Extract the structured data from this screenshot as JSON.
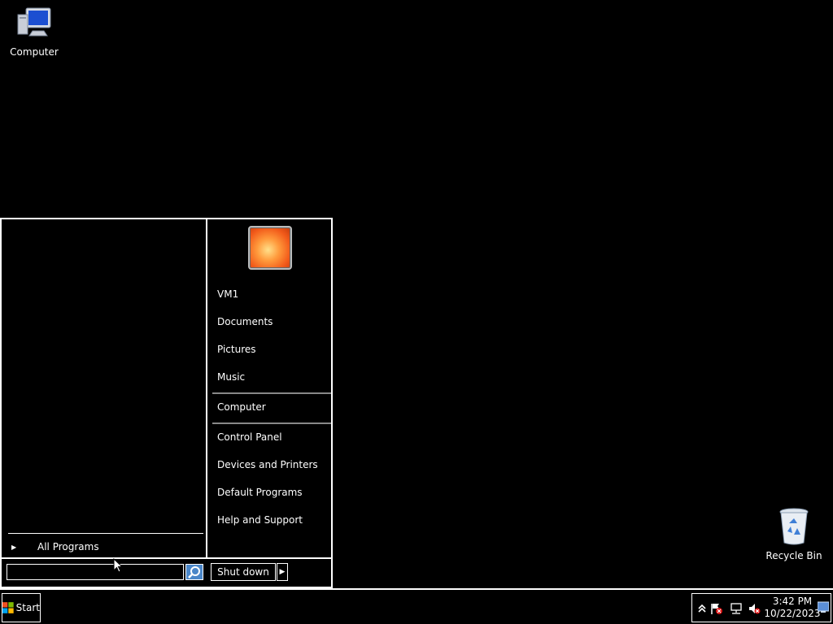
{
  "desktop": {
    "icons": [
      {
        "label": "Computer",
        "icon": "computer-icon"
      },
      {
        "label": "Recycle Bin",
        "icon": "recycle-bin-icon"
      }
    ]
  },
  "start_menu": {
    "all_programs": "All Programs",
    "search": {
      "value": "",
      "placeholder": ""
    },
    "right_items": {
      "user": "VM1",
      "documents": "Documents",
      "pictures": "Pictures",
      "music": "Music",
      "computer": "Computer",
      "control_panel": "Control Panel",
      "devices_printers": "Devices and Printers",
      "default_programs": "Default Programs",
      "help_support": "Help and Support"
    },
    "shutdown_label": "Shut down"
  },
  "taskbar": {
    "start_label": "Start",
    "clock": {
      "time": "3:42 PM",
      "date": "10/22/2023"
    }
  },
  "colors": {
    "background": "#000000",
    "text": "#ffffff",
    "border": "#ffffff",
    "search_button": "#4a86c8"
  }
}
